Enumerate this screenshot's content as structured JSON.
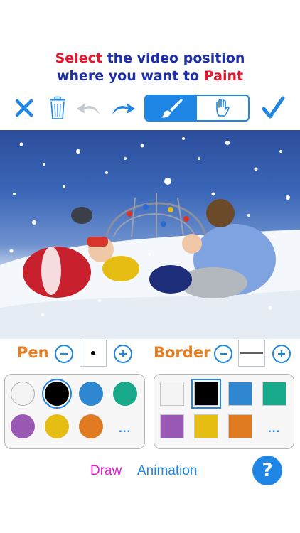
{
  "instruction": {
    "line1_accent": "Select",
    "line1_rest": "the video position",
    "line2_rest": "where you want to",
    "line2_accent": "Paint"
  },
  "toolbar": {
    "icons": [
      "close-icon",
      "trash-icon",
      "undo-icon",
      "redo-icon",
      "brush-icon",
      "hand-icon",
      "checkmark-icon"
    ],
    "active_mode": "brush"
  },
  "controls": {
    "pen_label": "Pen",
    "border_label": "Border"
  },
  "pen_palette": {
    "colors": [
      "#f4f4f4",
      "#000000",
      "#2f86d1",
      "#17a98a",
      "#9b59b6",
      "#e6bd13",
      "#e07b22"
    ],
    "selected": "#000000",
    "more": "..."
  },
  "border_palette": {
    "colors": [
      "#f4f4f4",
      "#000000",
      "#2f86d1",
      "#17a98a",
      "#9b59b6",
      "#e6bd13",
      "#e07b22"
    ],
    "selected": "#000000",
    "more": "..."
  },
  "footer": {
    "draw_tab": "Draw",
    "animation_tab": "Animation",
    "help": "?"
  },
  "colors": {
    "accent_blue": "#1f86e6",
    "accent_orange": "#e67e22",
    "draw_tab": "#e61bd6",
    "animation_tab": "#1f86e6"
  }
}
